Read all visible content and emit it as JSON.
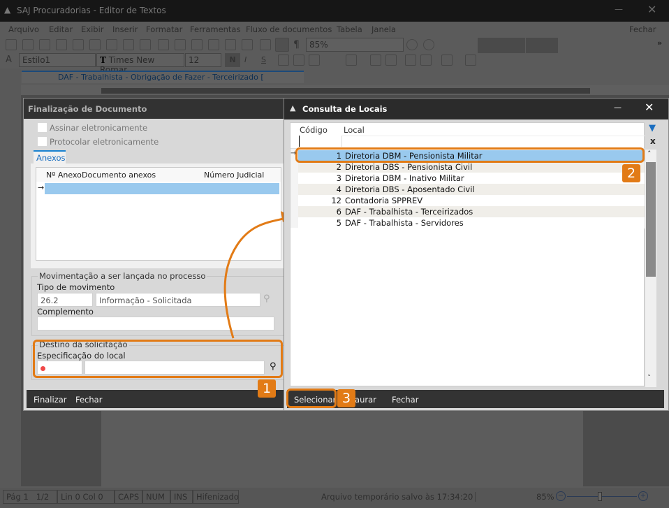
{
  "app": {
    "title": "SAJ Procuradorias - Editor de Textos",
    "close_label": "Fechar"
  },
  "menu": [
    "Arquivo",
    "Editar",
    "Exibir",
    "Inserir",
    "Formatar",
    "Ferramentas",
    "Fluxo de documentos",
    "Tabela",
    "Janela"
  ],
  "toolbar": {
    "zoom": "85%",
    "style": "Estilo1",
    "font": "Times New Romar",
    "size": "12",
    "bold": "N",
    "italic": "I",
    "strike": "S"
  },
  "doc_tab": "DAF - Trabalhista - Obrigação de Fazer - Terceirizado [",
  "status": {
    "page": "Pág 1",
    "pages": "1/2",
    "pos": "Lin 0  Col 0",
    "caps": "CAPS",
    "num": "NUM",
    "ins": "INS",
    "hyph": "Hifenizado",
    "saved": "Arquivo temporário salvo às 17:34:20",
    "zoom": "85%"
  },
  "finalizacao": {
    "title": "Finalização de Documento",
    "assinar": "Assinar eletronicamente",
    "protocolar": "Protocolar eletronicamente",
    "tab": "Anexos",
    "columns": [
      "Nº Anexo",
      "Documento anexos",
      "Número Judicial"
    ],
    "mov_group": "Movimentação a ser lançada no processo",
    "tipo_label": "Tipo de movimento",
    "tipo_code": "26.2",
    "tipo_desc": "Informação - Solicitada",
    "complemento_label": "Complemento",
    "destino_group": "Destino da solicitação",
    "especificacao_label": "Especificação do local",
    "buttons": {
      "finalizar": "Finalizar",
      "fechar": "Fechar"
    }
  },
  "consulta": {
    "title": "Consulta de Locais",
    "columns": [
      "Código",
      "Local"
    ],
    "rows": [
      {
        "codigo": "1",
        "local": "Diretoria DBM - Pensionista Militar",
        "selected": true
      },
      {
        "codigo": "2",
        "local": "Diretoria DBS - Pensionista Civil"
      },
      {
        "codigo": "3",
        "local": "Diretoria DBM - Inativo Militar"
      },
      {
        "codigo": "4",
        "local": "Diretoria DBS - Aposentado Civil"
      },
      {
        "codigo": "12",
        "local": "Contadoria SPPREV"
      },
      {
        "codigo": "6",
        "local": "DAF - Trabalhista - Terceirizados"
      },
      {
        "codigo": "5",
        "local": "DAF - Trabalhista - Servidores"
      }
    ],
    "buttons": {
      "selecionar": "Selecionar",
      "restaurar": "Restaurar",
      "fechar": "Fechar"
    }
  },
  "callouts": [
    "1",
    "2",
    "3"
  ],
  "colors": {
    "accent": "#e27b16",
    "selection": "#99c9ee"
  }
}
